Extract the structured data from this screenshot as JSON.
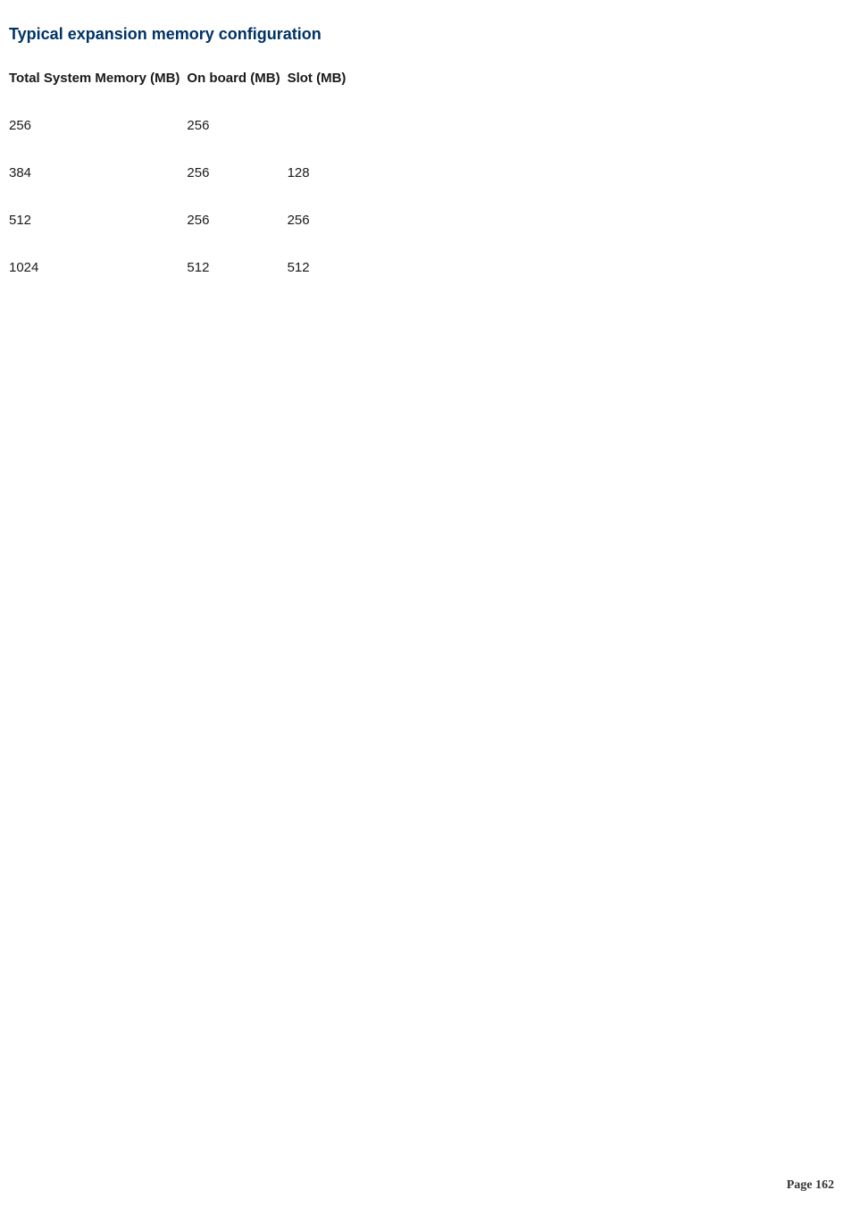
{
  "title": "Typical expansion memory configuration",
  "table": {
    "headers": [
      "Total System Memory (MB)",
      "On board (MB)",
      "Slot (MB)"
    ],
    "rows": [
      {
        "total": "256",
        "onboard": "256",
        "slot": ""
      },
      {
        "total": "384",
        "onboard": "256",
        "slot": "128"
      },
      {
        "total": "512",
        "onboard": "256",
        "slot": "256"
      },
      {
        "total": "1024",
        "onboard": "512",
        "slot": "512"
      }
    ]
  },
  "footer": "Page 162"
}
